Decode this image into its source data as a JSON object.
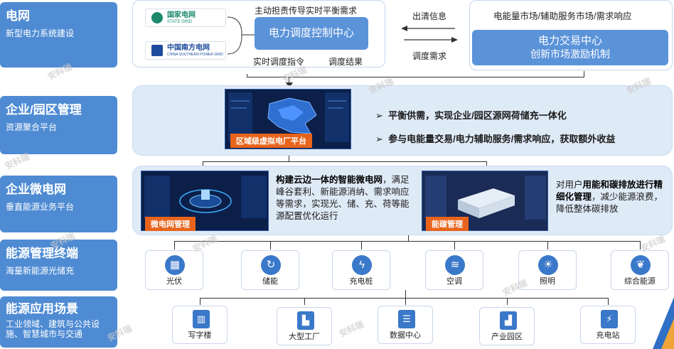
{
  "layers": [
    {
      "title": "电网",
      "subtitle": "新型电力系统建设"
    },
    {
      "title": "企业/园区管理",
      "subtitle": "资源聚合平台"
    },
    {
      "title": "企业微电网",
      "subtitle": "垂直能源业务平台"
    },
    {
      "title": "能源管理终端",
      "subtitle": "海量新能源光储充"
    },
    {
      "title": "能源应用场景",
      "subtitle": "工业领域、建筑与公共设施、智慧城市与交通"
    }
  ],
  "grid": {
    "logo1_main": "国家电网",
    "logo1_sub": "STATE GRID",
    "logo2_main": "中国南方电网",
    "logo2_sub": "CHINA SOUTHERN POWER GRID",
    "top_note": "主动担责传导实时平衡需求",
    "dispatch_center": "电力调度控制中心",
    "bottom_left_note": "实时调度指令",
    "bottom_right_note": "调度结果",
    "arrow_top": "出清信息",
    "arrow_bottom": "调度需求",
    "market_note": "电能量市场/辅助服务市场/需求响应",
    "trading_line1": "电力交易中心",
    "trading_line2": "创新市场激励机制"
  },
  "platform": {
    "screen_tag": "区域级虚拟电厂平台",
    "bullet1": "平衡供需，实现企业/园区源网荷储充一体化",
    "bullet2": "参与电能量交易/电力辅助服务/需求响应，获取额外收益"
  },
  "micro": {
    "screen1_tag": "微电网管理",
    "para1_bold": "构建云边一体的智能微电网",
    "para1_rest": "，满足峰谷套利、新能源消纳、需求响应等需求，实现光、储、充、荷等能源配置优化运行",
    "screen2_tag": "能碳管理",
    "para2_pre": "对用户",
    "para2_bold": "用能和碳排放进行精细化管理",
    "para2_rest": "，减少能源浪费，降低整体碳排放"
  },
  "terminals": [
    {
      "label": "光伏",
      "icon": "solar-panel-icon"
    },
    {
      "label": "储能",
      "icon": "energy-storage-icon"
    },
    {
      "label": "充电桩",
      "icon": "charging-pile-icon"
    },
    {
      "label": "空调",
      "icon": "air-conditioner-icon"
    },
    {
      "label": "照明",
      "icon": "lighting-icon"
    },
    {
      "label": "综合能源",
      "icon": "integrated-energy-icon"
    }
  ],
  "scenarios": [
    {
      "label": "写字楼",
      "icon": "office-building-icon"
    },
    {
      "label": "大型工厂",
      "icon": "factory-icon"
    },
    {
      "label": "数据中心",
      "icon": "data-center-icon"
    },
    {
      "label": "产业园区",
      "icon": "industrial-park-icon"
    },
    {
      "label": "充电站",
      "icon": "charging-station-icon"
    }
  ],
  "watermark": "安科瑞",
  "colors": {
    "label_bg": "#4f8bd3",
    "row_bg": "#dfeaf7",
    "accent_orange": "#e8641c",
    "icon_blue": "#3a78c9"
  }
}
